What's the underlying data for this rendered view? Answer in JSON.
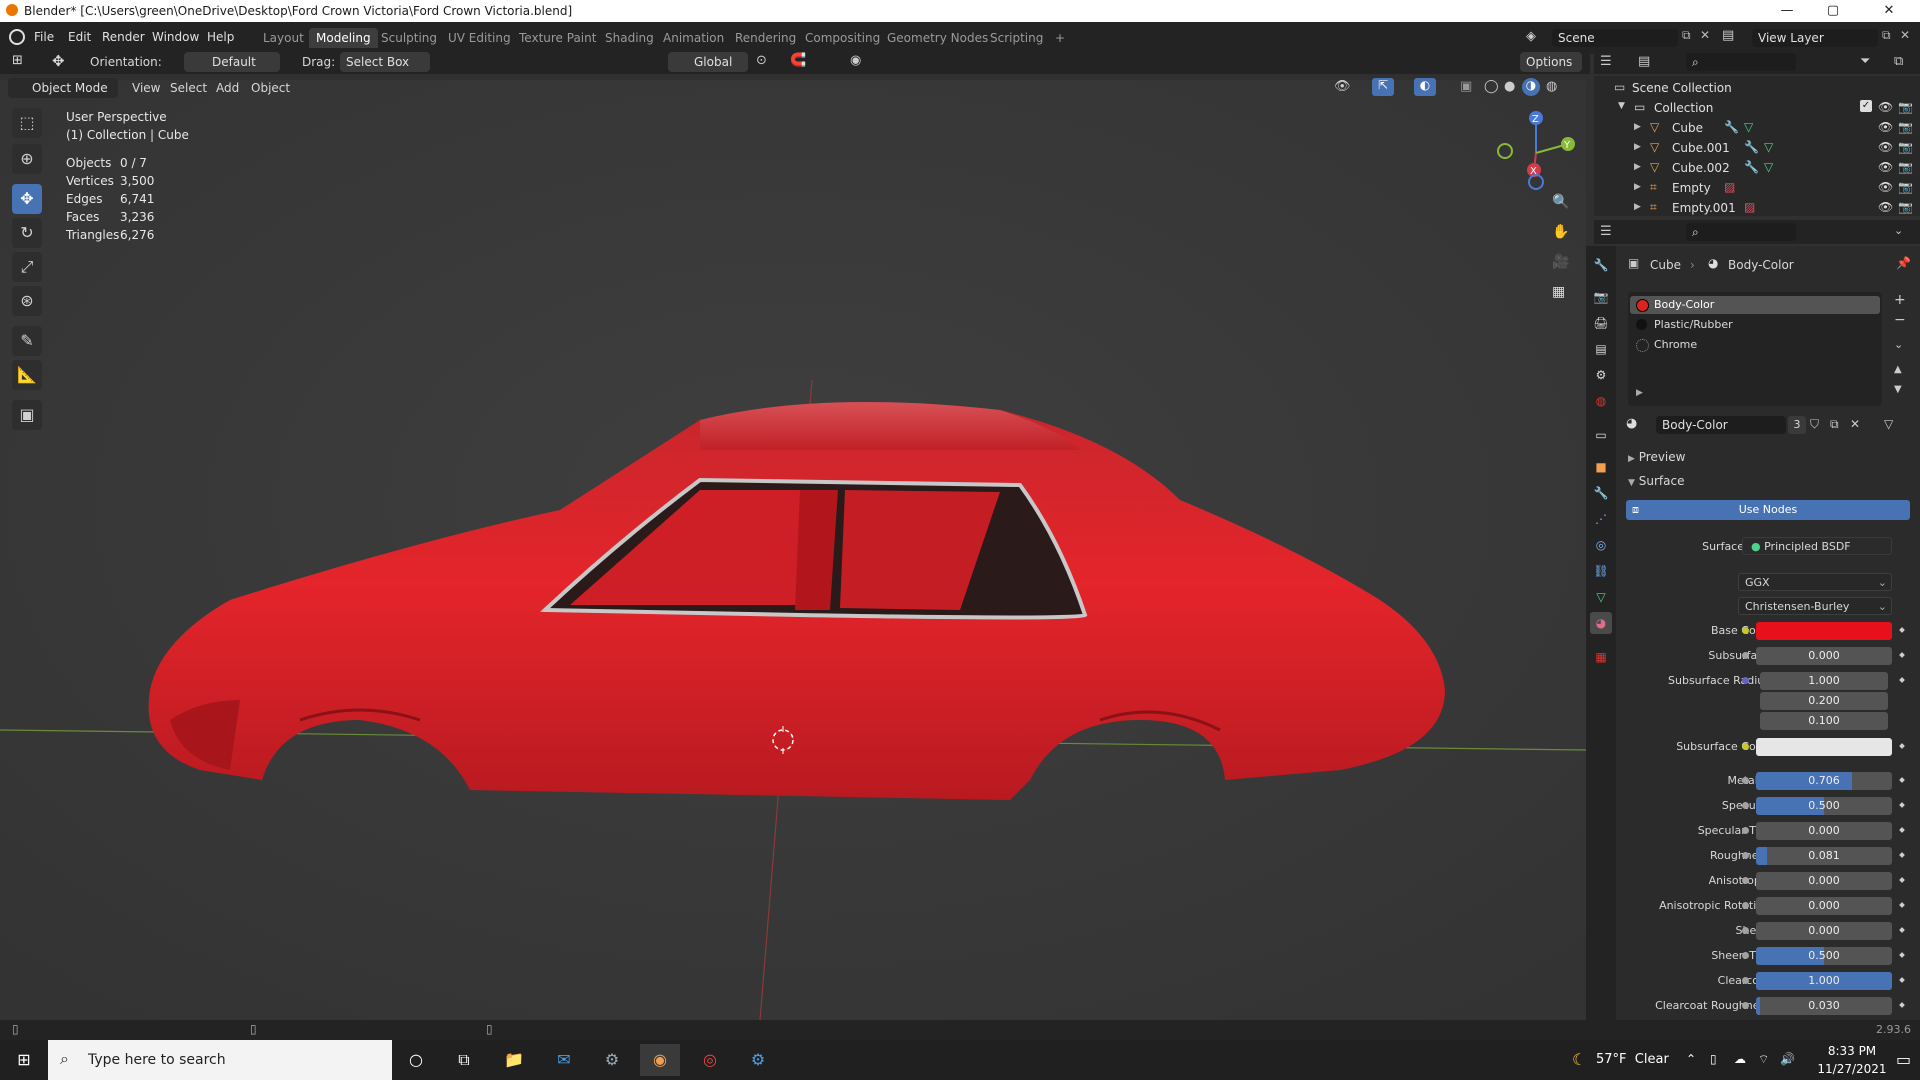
{
  "window": {
    "title": "Blender* [C:\\Users\\green\\OneDrive\\Desktop\\Ford Crown Victoria\\Ford Crown Victoria.blend]",
    "minimize": "—",
    "maximize": "▢",
    "close": "✕"
  },
  "menu": {
    "items": [
      "File",
      "Edit",
      "Render",
      "Window",
      "Help"
    ],
    "workspaces": [
      "Layout",
      "Modeling",
      "Sculpting",
      "UV Editing",
      "Texture Paint",
      "Shading",
      "Animation",
      "Rendering",
      "Compositing",
      "Geometry Nodes",
      "Scripting"
    ],
    "active_workspace": "Modeling",
    "add_tab": "+",
    "scene": "Scene",
    "view_layer": "View Layer"
  },
  "tool_header": {
    "orientation_label": "Orientation:",
    "orientation_value": "Default",
    "drag_label": "Drag:",
    "drag_value": "Select Box",
    "transform_orientation": "Global",
    "options": "Options"
  },
  "viewport_header": {
    "mode": "Object Mode",
    "menus": [
      "View",
      "Select",
      "Add",
      "Object"
    ]
  },
  "viewport": {
    "perspective": "User Perspective",
    "collection_info": "(1) Collection | Cube",
    "stats": [
      {
        "label": "Objects",
        "value": "0 / 7"
      },
      {
        "label": "Vertices",
        "value": "3,500"
      },
      {
        "label": "Edges",
        "value": "6,741"
      },
      {
        "label": "Faces",
        "value": "3,236"
      },
      {
        "label": "Triangles",
        "value": "6,276"
      }
    ],
    "gizmo": {
      "z": "Z",
      "y": "Y",
      "x": "X"
    }
  },
  "outliner": {
    "root": "Scene Collection",
    "collection": "Collection",
    "objects": [
      "Cube",
      "Cube.001",
      "Cube.002",
      "Empty",
      "Empty.001"
    ]
  },
  "properties": {
    "breadcrumb_object": "Cube",
    "breadcrumb_material": "Body-Color",
    "material_slots": [
      "Body-Color",
      "Plastic/Rubber",
      "Chrome"
    ],
    "active_slot": "Body-Color",
    "material_name": "Body-Color",
    "user_count": "3",
    "preview_panel": "Preview",
    "surface_panel": "Surface",
    "use_nodes": "Use Nodes",
    "surface_label": "Surface",
    "surface_shader": "Principled BSDF",
    "distribution": "GGX",
    "subsurface_method": "Christensen-Burley",
    "base_color_label": "Base Color",
    "base_color": "#e8101a",
    "subsurface_color_label": "Subsurface Color",
    "subsurface_color": "#e6e6e6",
    "subsurface_radius_label": "Subsurface Radius",
    "subsurface_radius": [
      "1.000",
      "0.200",
      "0.100"
    ],
    "sliders": [
      {
        "label": "Subsurface",
        "value": "0.000",
        "fraction": 0
      },
      {
        "label": "Metallic",
        "value": "0.706",
        "fraction": 0.706
      },
      {
        "label": "Specular",
        "value": "0.500",
        "fraction": 0.5
      },
      {
        "label": "Specular Tint",
        "value": "0.000",
        "fraction": 0
      },
      {
        "label": "Roughness",
        "value": "0.081",
        "fraction": 0.081
      },
      {
        "label": "Anisotropic",
        "value": "0.000",
        "fraction": 0
      },
      {
        "label": "Anisotropic Rotation",
        "value": "0.000",
        "fraction": 0
      },
      {
        "label": "Sheen",
        "value": "0.000",
        "fraction": 0
      },
      {
        "label": "Sheen Tint",
        "value": "0.500",
        "fraction": 0.5
      },
      {
        "label": "Clearcoat",
        "value": "1.000",
        "fraction": 1
      },
      {
        "label": "Clearcoat Roughne...",
        "value": "0.030",
        "fraction": 0.03
      }
    ]
  },
  "statusbar": {
    "version": "2.93.6"
  },
  "taskbar": {
    "search_placeholder": "Type here to search",
    "weather": "57°F  Clear",
    "time": "8:33 PM",
    "date": "11/27/2021"
  }
}
